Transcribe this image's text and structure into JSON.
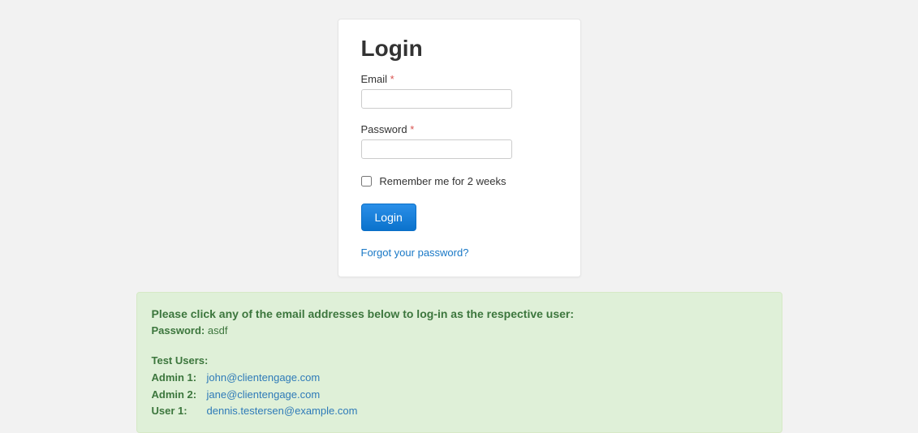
{
  "login": {
    "title": "Login",
    "email_label": "Email",
    "password_label": "Password",
    "required_mark": "*",
    "email_value": "",
    "password_value": "",
    "remember_label": "Remember me for 2 weeks",
    "submit_label": "Login",
    "forgot_label": "Forgot your password?"
  },
  "info": {
    "heading": "Please click any of the email addresses below to log-in as the respective user:",
    "password_label": "Password:",
    "password_value": "asdf",
    "test_users_heading": "Test Users:",
    "users": [
      {
        "role": "Admin 1:",
        "email": "john@clientengage.com"
      },
      {
        "role": "Admin 2:",
        "email": "jane@clientengage.com"
      },
      {
        "role": "User 1:",
        "email": "dennis.testersen@example.com"
      }
    ]
  }
}
